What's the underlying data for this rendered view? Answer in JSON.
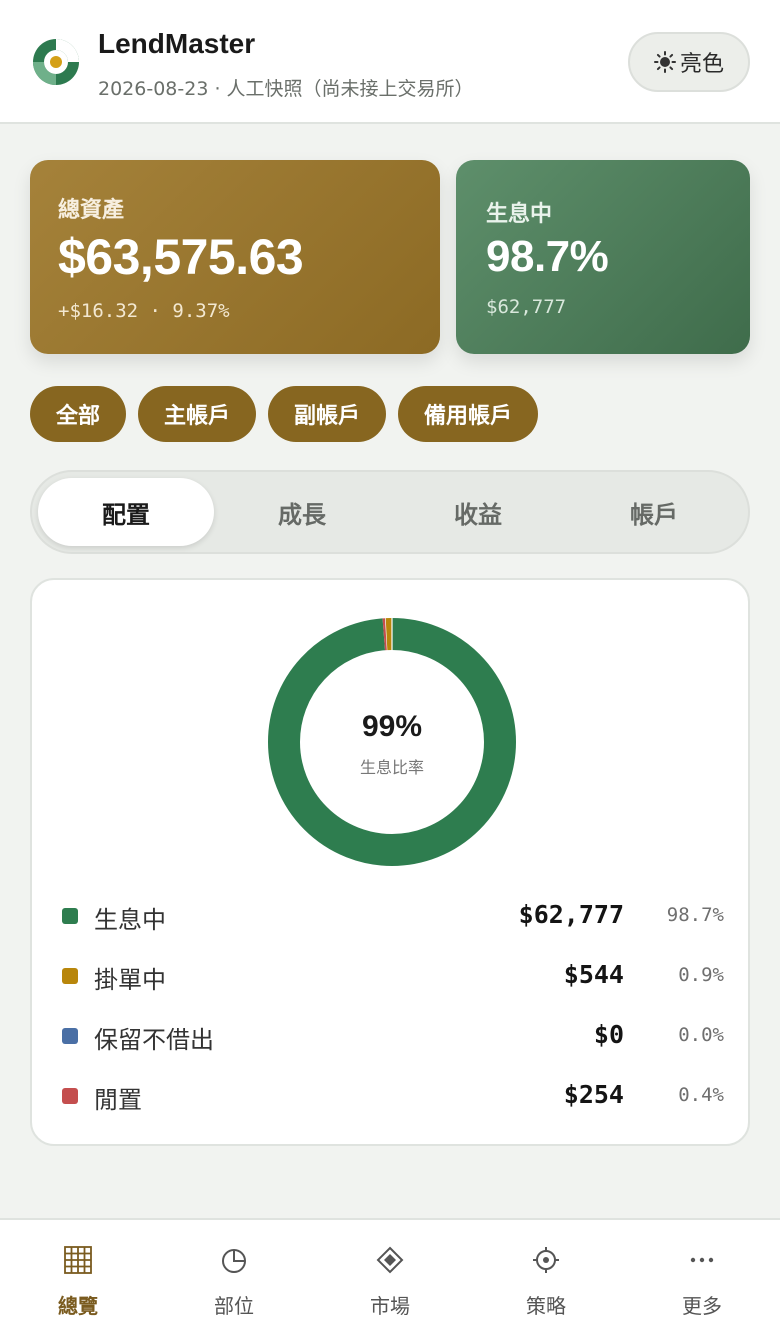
{
  "header": {
    "title": "LendMaster",
    "subtitle": "2026-08-23 · 人工快照（尚未接上交易所）",
    "theme_button_label": "亮色",
    "theme_icon": "sun-icon"
  },
  "summary": {
    "total": {
      "label": "總資產",
      "value": "$63,575.63",
      "change": "+$16.32 · 9.37%"
    },
    "yield": {
      "label": "生息中",
      "value": "98.7%",
      "amount": "$62,777"
    }
  },
  "account_filters": [
    "全部",
    "主帳戶",
    "副帳戶",
    "備用帳戶"
  ],
  "tabs": [
    {
      "label": "配置",
      "active": true
    },
    {
      "label": "成長",
      "active": false
    },
    {
      "label": "收益",
      "active": false
    },
    {
      "label": "帳戶",
      "active": false
    }
  ],
  "chart_data": {
    "type": "pie",
    "center_value": "99%",
    "center_label": "生息比率",
    "categories": [
      "生息中",
      "掛單中",
      "保留不借出",
      "閒置"
    ],
    "values": [
      62777,
      544,
      0,
      254
    ],
    "percent_labels": [
      "98.7%",
      "0.9%",
      "0.0%",
      "0.4%"
    ],
    "amount_labels": [
      "$62,777",
      "$544",
      "$0",
      "$254"
    ],
    "colors": [
      "#2e7d4f",
      "#b8860b",
      "#4a6fa5",
      "#c44e4e"
    ]
  },
  "bottom_nav": [
    {
      "label": "總覽",
      "icon": "grid-icon",
      "active": true
    },
    {
      "label": "部位",
      "icon": "pie-chart-icon",
      "active": false
    },
    {
      "label": "市場",
      "icon": "diamond-icon",
      "active": false
    },
    {
      "label": "策略",
      "icon": "target-icon",
      "active": false
    },
    {
      "label": "更多",
      "icon": "more-icon",
      "active": false
    }
  ]
}
